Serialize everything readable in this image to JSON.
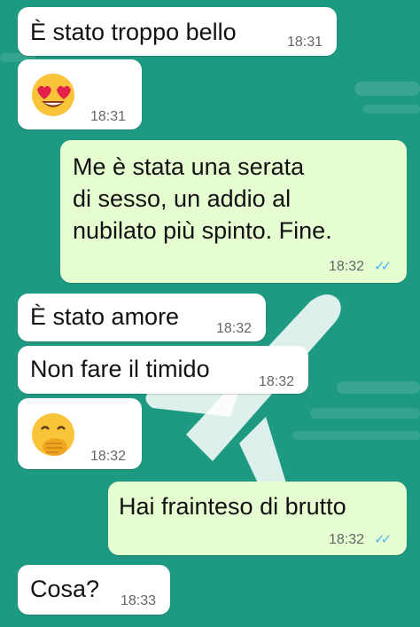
{
  "messages": [
    {
      "dir": "in",
      "text": "È stato troppo bello",
      "time": "18:31"
    },
    {
      "dir": "in",
      "emoji": "heart-eyes",
      "time": "18:31"
    },
    {
      "dir": "out",
      "lines": [
        "Me è stata una serata",
        "di sesso, un addio al",
        "nubilato più spinto. Fine."
      ],
      "time": "18:32",
      "status": "read"
    },
    {
      "dir": "in",
      "text": "È stato amore",
      "time": "18:32"
    },
    {
      "dir": "in",
      "text": "Non fare il timido",
      "time": "18:32"
    },
    {
      "dir": "in",
      "emoji": "hand-over-mouth",
      "time": "18:32"
    },
    {
      "dir": "out",
      "text": "Hai frainteso di brutto",
      "time": "18:32",
      "status": "read"
    },
    {
      "dir": "in",
      "text": "Cosa?",
      "time": "18:33"
    }
  ],
  "colors": {
    "wallpaper": "#1f9a82",
    "incoming": "#ffffff",
    "outgoing": "#e6fcd1",
    "read_ticks": "#4fb6ec"
  },
  "icons": {
    "read_receipt": "double-check-icon"
  },
  "glyphs": {
    "read_ticks": "✓✓"
  }
}
